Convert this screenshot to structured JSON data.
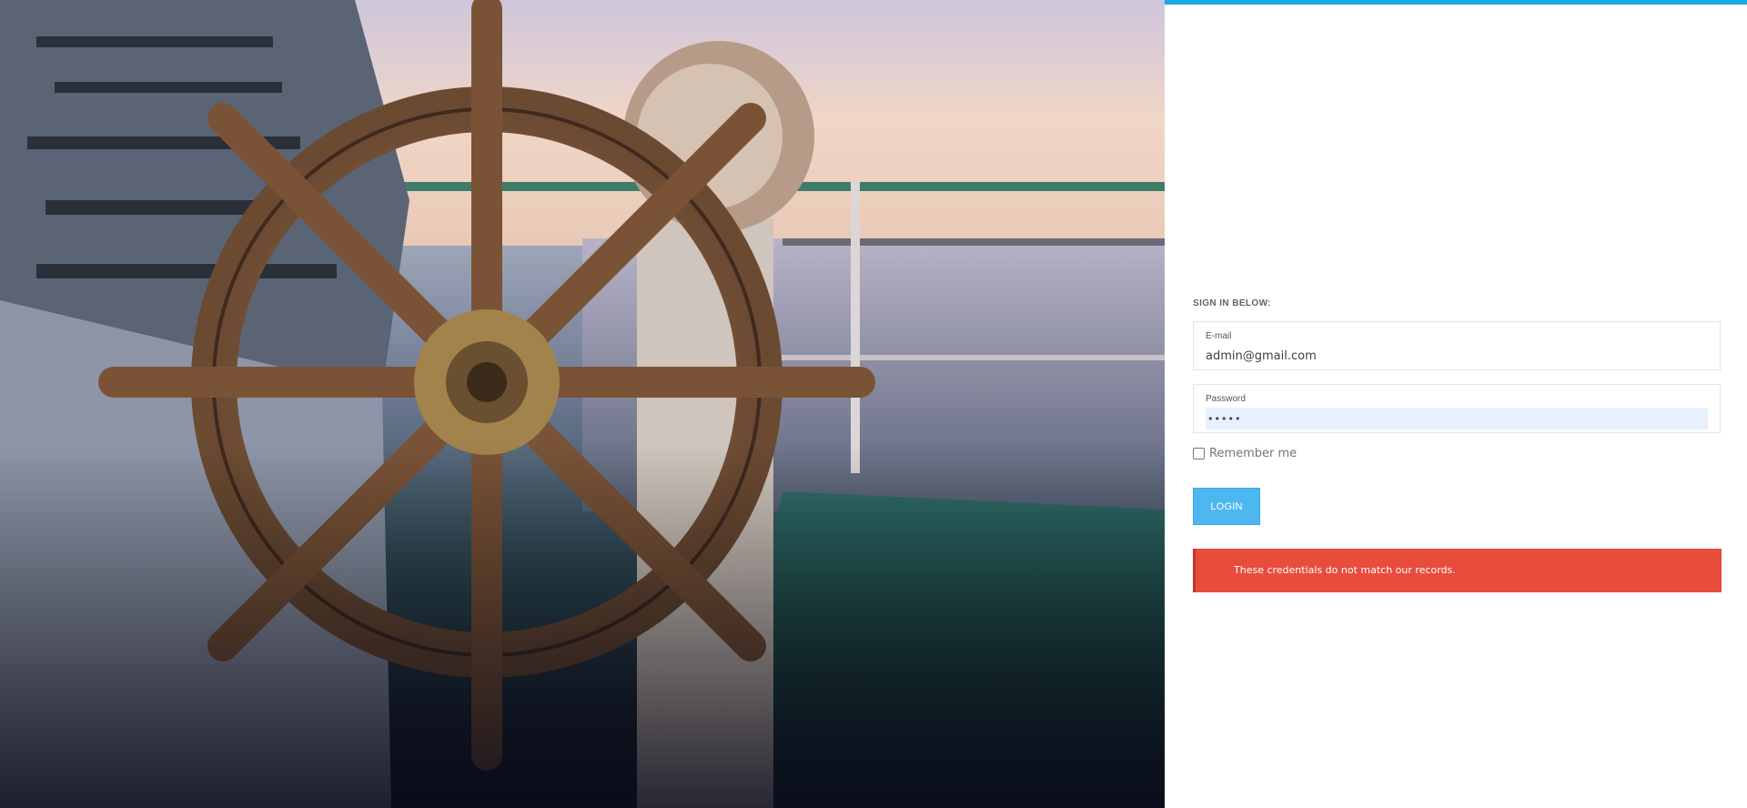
{
  "hero": {
    "image_description_icon": "ship-wheel-image"
  },
  "login": {
    "heading": "SIGN IN BELOW:",
    "email": {
      "label": "E-mail",
      "value": "admin@gmail.com"
    },
    "password": {
      "label": "Password",
      "value": "•••••"
    },
    "remember_label": "Remember me",
    "remember_checked": false,
    "button_label": "LOGIN",
    "error_message": "These credentials do not match our records."
  },
  "colors": {
    "accent_bar": "#1ea7e6",
    "button": "#4db8f0",
    "error": "#e74c3c"
  }
}
